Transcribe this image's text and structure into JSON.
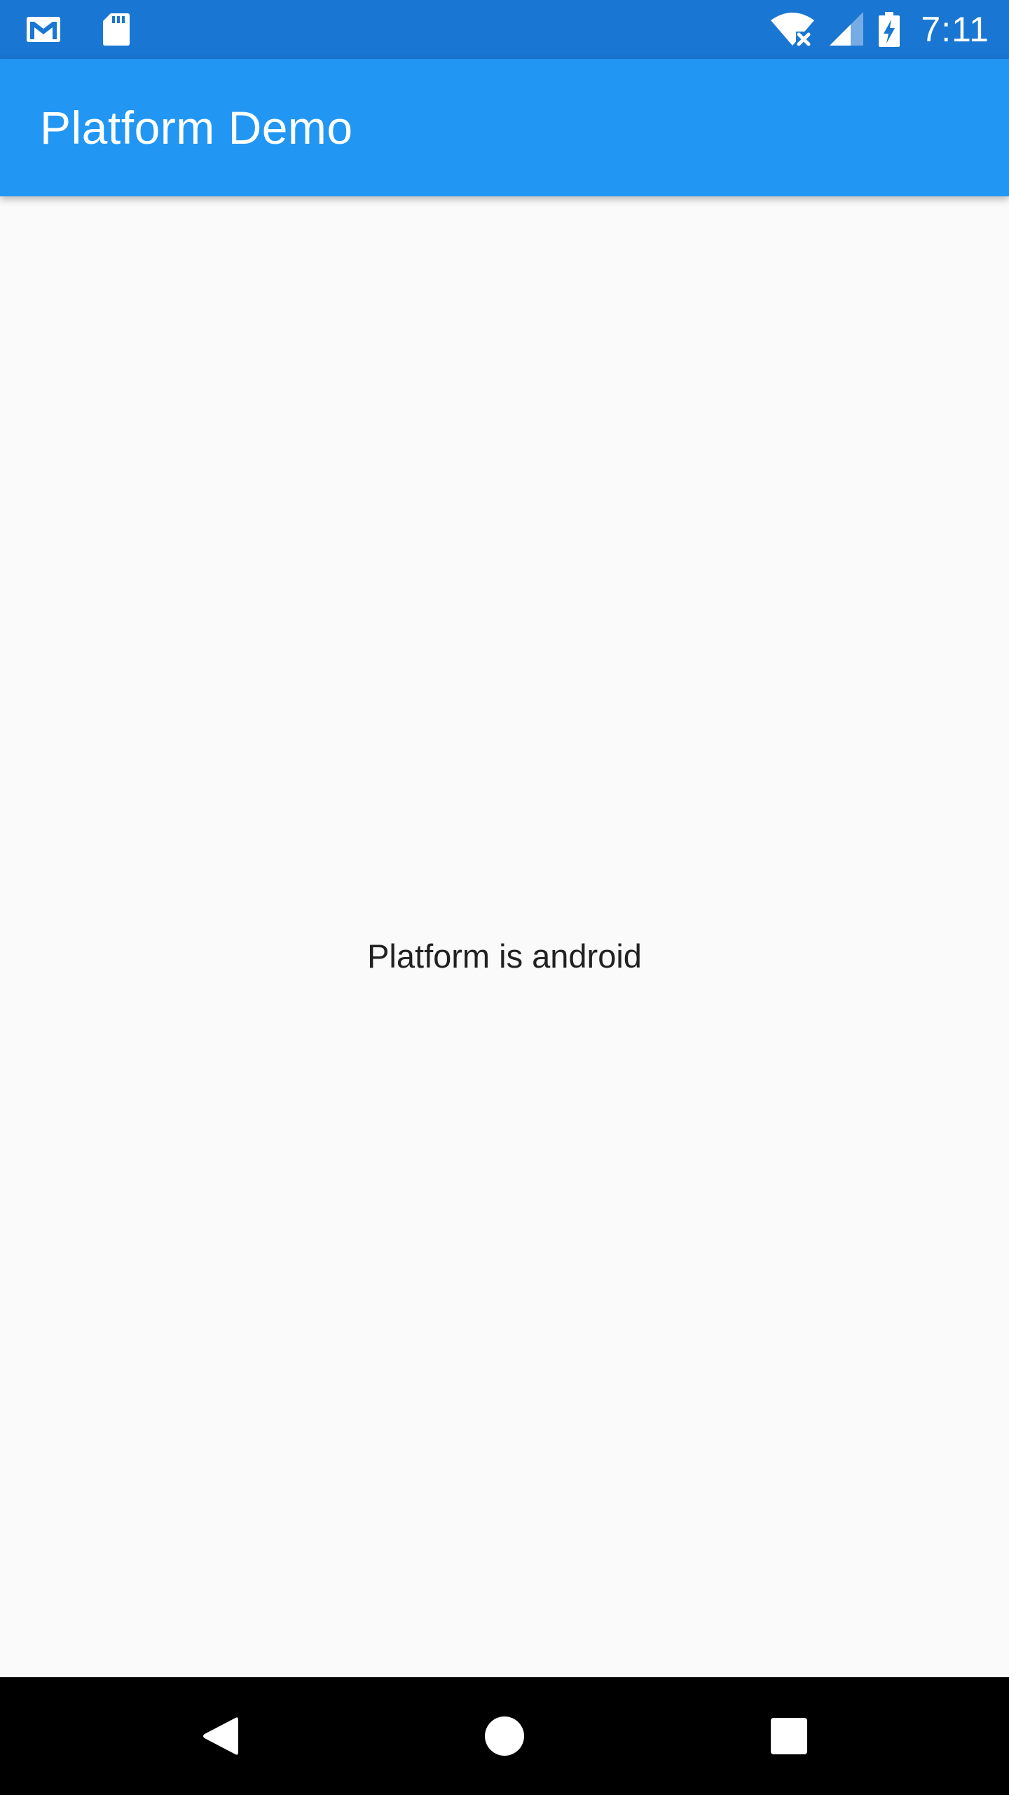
{
  "status_bar": {
    "time": "7:11",
    "icons": [
      "gmail-icon",
      "sd-card-icon",
      "wifi-off-icon",
      "cell-signal-icon",
      "battery-charging-icon"
    ],
    "background": "#1976d2"
  },
  "app_bar": {
    "title": "Platform Demo",
    "background": "#2196f3"
  },
  "body": {
    "message": "Platform is android",
    "background": "#fafafa"
  },
  "nav_bar": {
    "buttons": [
      "back-icon",
      "home-icon",
      "recents-icon"
    ],
    "background": "#000000"
  }
}
